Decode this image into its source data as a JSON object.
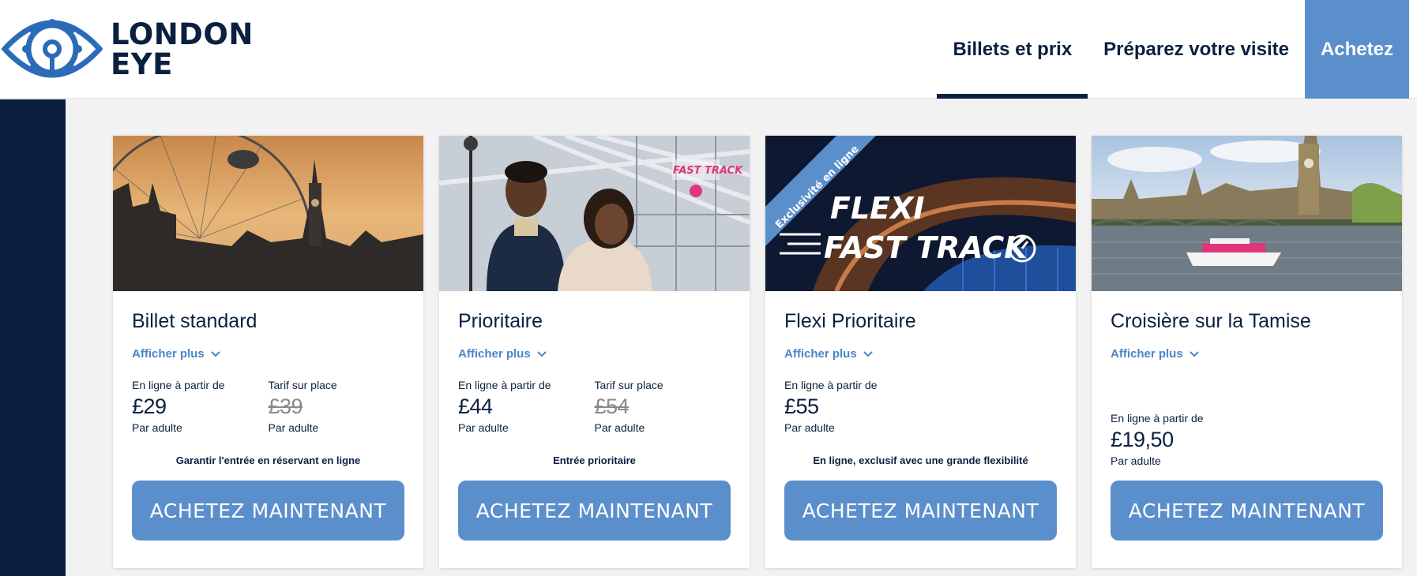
{
  "logo": {
    "line1": "LONDON",
    "line2": "EYE"
  },
  "nav": {
    "tickets": "Billets et prix",
    "visit": "Préparez votre visite",
    "buy": "Achetez"
  },
  "colors": {
    "navy": "#0b1f3f",
    "accent_blue": "#5b8fcb",
    "link_blue": "#4a86c5"
  },
  "cards": [
    {
      "title": "Billet standard",
      "show_more": "Afficher plus",
      "online_label": "En ligne à partir de",
      "online_price": "£29",
      "online_unit": "Par adulte",
      "onsite_label": "Tarif sur place",
      "onsite_price": "£39",
      "onsite_unit": "Par adulte",
      "tagline": "Garantir l'entrée en réservant en ligne",
      "button": "ACHETEZ MAINTENANT"
    },
    {
      "title": "Prioritaire",
      "show_more": "Afficher plus",
      "online_label": "En ligne à partir de",
      "online_price": "£44",
      "online_unit": "Par adulte",
      "onsite_label": "Tarif sur place",
      "onsite_price": "£54",
      "onsite_unit": "Par adulte",
      "tagline": "Entrée prioritaire",
      "button": "ACHETEZ MAINTENANT",
      "image_sign": "FAST TRACK"
    },
    {
      "title": "Flexi Prioritaire",
      "show_more": "Afficher plus",
      "online_label": "En ligne à partir de",
      "online_price": "£55",
      "online_unit": "Par adulte",
      "tagline": "En ligne, exclusif avec une grande flexibilité",
      "button": "ACHETEZ MAINTENANT",
      "image_ribbon": "Exclusivité en ligne",
      "image_line1": "FLEXI",
      "image_line2": "FAST TRACK"
    },
    {
      "title": "Croisière sur la Tamise",
      "show_more": "Afficher plus",
      "online_label": "En ligne à partir de",
      "online_price": "£19,50",
      "online_unit": "Par adulte",
      "button": "ACHETEZ MAINTENANT"
    }
  ]
}
